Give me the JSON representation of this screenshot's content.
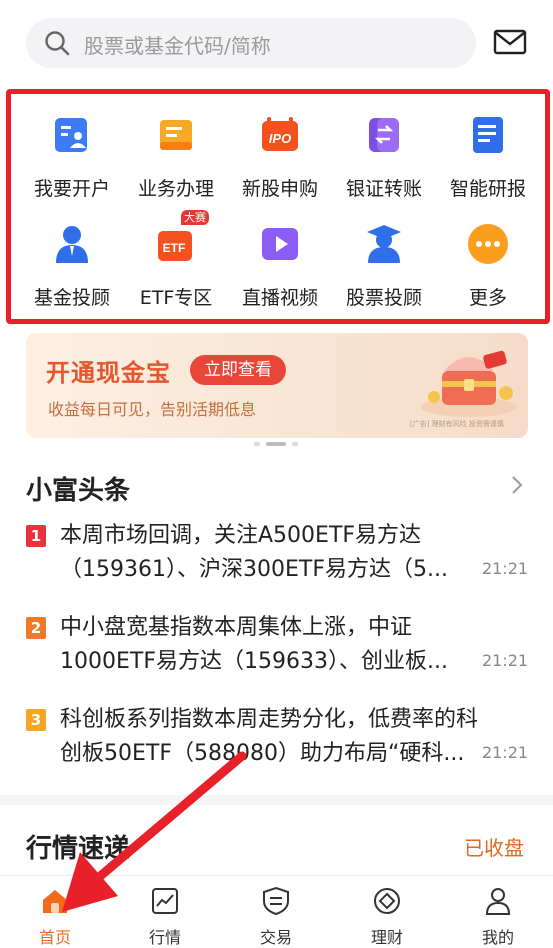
{
  "search": {
    "placeholder": "股票或基金代码/简称"
  },
  "quick_entries": [
    {
      "label": "我要开户",
      "icon": "open-account-icon"
    },
    {
      "label": "业务办理",
      "icon": "business-handling-icon"
    },
    {
      "label": "新股申购",
      "icon": "ipo-icon",
      "icon_text": "IPO"
    },
    {
      "label": "银证转账",
      "icon": "bank-transfer-icon"
    },
    {
      "label": "智能研报",
      "icon": "research-report-icon"
    },
    {
      "label": "基金投顾",
      "icon": "fund-advisor-icon"
    },
    {
      "label": "ETF专区",
      "icon": "etf-zone-icon",
      "icon_text": "ETF",
      "tag": "大赛"
    },
    {
      "label": "直播视频",
      "icon": "live-video-icon"
    },
    {
      "label": "股票投顾",
      "icon": "stock-advisor-icon"
    },
    {
      "label": "更多",
      "icon": "more-icon"
    }
  ],
  "banner": {
    "title": "开通现金宝",
    "cta": "立即查看",
    "subtitle": "收益每日可见，告别活期低息",
    "fine_print": "[广告] 理财有风险 投资需谨慎"
  },
  "news": {
    "title": "小富头条",
    "items": [
      {
        "rank": "1",
        "text": "本周市场回调，关注A500ETF易方达（159361）、沪深300ETF易方达（5...",
        "time": "21:21",
        "color": "#e8333b"
      },
      {
        "rank": "2",
        "text": "中小盘宽基指数本周集体上涨，中证1000ETF易方达（159633）、创业板...",
        "time": "21:21",
        "color": "#f07a2a"
      },
      {
        "rank": "3",
        "text": "科创板系列指数本周走势分化，低费率的科创板50ETF（588080）助力布局“硬科...",
        "time": "21:21",
        "color": "#f5a623"
      }
    ]
  },
  "market": {
    "title": "行情速递",
    "status": "已收盘"
  },
  "tabbar": [
    {
      "label": "首页",
      "icon": "home-icon",
      "active": true
    },
    {
      "label": "行情",
      "icon": "chart-icon",
      "active": false
    },
    {
      "label": "交易",
      "icon": "trade-icon",
      "active": false
    },
    {
      "label": "理财",
      "icon": "wealth-icon",
      "active": false
    },
    {
      "label": "我的",
      "icon": "profile-icon",
      "active": false
    }
  ],
  "colors": {
    "accent": "#f26a1b",
    "highlight_border": "#e8202a",
    "arrow": "#e8202a"
  }
}
